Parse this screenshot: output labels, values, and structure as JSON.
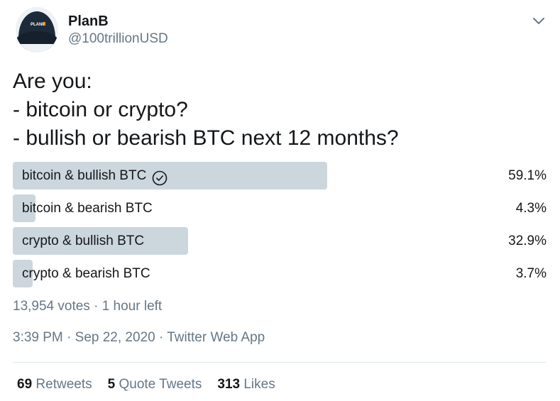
{
  "author": {
    "name": "PlanB",
    "handle": "@100trillionUSD",
    "avatar_text": "PLANB"
  },
  "tweet": {
    "text": "Are you:\n- bitcoin or crypto?\n- bullish or bearish BTC next 12 months?"
  },
  "poll": {
    "options": [
      {
        "label": "bitcoin & bullish BTC",
        "percent": "59.1%",
        "fraction": 0.591,
        "winner": true
      },
      {
        "label": "bitcoin & bearish BTC",
        "percent": "4.3%",
        "fraction": 0.043,
        "winner": false
      },
      {
        "label": "crypto & bullish BTC",
        "percent": "32.9%",
        "fraction": 0.329,
        "winner": false
      },
      {
        "label": "crypto & bearish BTC",
        "percent": "3.7%",
        "fraction": 0.037,
        "winner": false
      }
    ],
    "votes": "13,954 votes",
    "separator": "·",
    "time_left": "1 hour left"
  },
  "meta": {
    "time": "3:39 PM",
    "separator": "·",
    "date": "Sep 22, 2020",
    "source": "Twitter Web App"
  },
  "stats": {
    "retweets_count": "69",
    "retweets_label": "Retweets",
    "quotes_count": "5",
    "quotes_label": "Quote Tweets",
    "likes_count": "313",
    "likes_label": "Likes"
  },
  "icons": {
    "caret": "chevron-down-icon",
    "winner": "check-circle-icon"
  },
  "colors": {
    "bar": "#ccd6dd",
    "secondary_text": "#657786",
    "primary_text": "#14171a"
  }
}
